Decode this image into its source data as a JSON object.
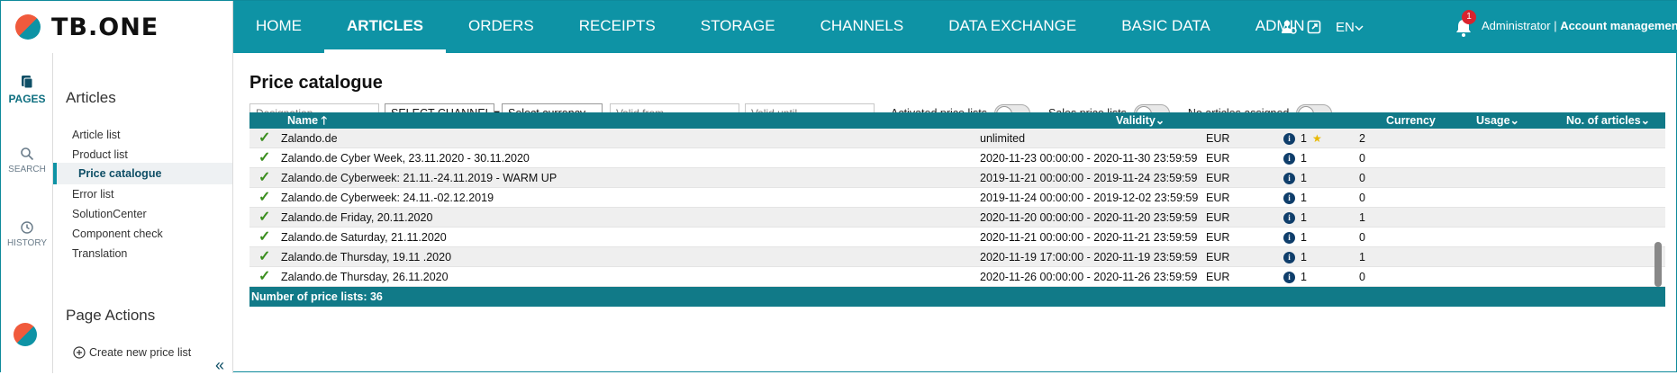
{
  "app": {
    "logo_text": "TB.ONE"
  },
  "nav": {
    "items": [
      {
        "label": "HOME",
        "active": false
      },
      {
        "label": "ARTICLES",
        "active": true
      },
      {
        "label": "ORDERS",
        "active": false
      },
      {
        "label": "RECEIPTS",
        "active": false
      },
      {
        "label": "STORAGE",
        "active": false
      },
      {
        "label": "CHANNELS",
        "active": false
      },
      {
        "label": "DATA EXCHANGE",
        "active": false
      },
      {
        "label": "BASIC DATA",
        "active": false
      },
      {
        "label": "ADMIN",
        "active": false
      }
    ],
    "language": "EN",
    "notification_count": "1",
    "user_name": "Administrator",
    "separator": " | ",
    "account_link": "Account management"
  },
  "rail": {
    "pages": "PAGES",
    "search": "SEARCH",
    "history": "HISTORY"
  },
  "sidebar": {
    "heading": "Articles",
    "links": [
      {
        "label": "Article list",
        "active": false
      },
      {
        "label": "Product list",
        "active": false
      },
      {
        "label": "Price catalogue",
        "active": true
      },
      {
        "label": "Error list",
        "active": false
      },
      {
        "label": "SolutionCenter",
        "active": false
      },
      {
        "label": "Component check",
        "active": false
      },
      {
        "label": "Translation",
        "active": false
      }
    ],
    "actions_heading": "Page Actions",
    "create_label": "Create new price list"
  },
  "main": {
    "title": "Price catalogue",
    "filters": {
      "designation_placeholder": "Designation",
      "channel_select": "SELECT CHANNEL",
      "currency_select": "Select currency",
      "valid_from_placeholder": "Valid from",
      "valid_until_placeholder": "Valid until",
      "toggle_activated": "Activated price lists",
      "toggle_sales": "Sales price lists",
      "toggle_no_articles": "No articles assigned"
    },
    "table": {
      "headers": {
        "name": "Name",
        "validity": "Validity",
        "currency": "Currency",
        "usage": "Usage",
        "articles": "No. of articles"
      },
      "rows": [
        {
          "name": "Zalando.de",
          "validity": "unlimited",
          "currency": "EUR",
          "usage": "1",
          "starred": true,
          "articles": "2"
        },
        {
          "name": "Zalando.de Cyber Week, 23.11.2020 - 30.11.2020",
          "validity": "2020-11-23 00:00:00 - 2020-11-30 23:59:59",
          "currency": "EUR",
          "usage": "1",
          "starred": false,
          "articles": "0"
        },
        {
          "name": "Zalando.de Cyberweek: 21.11.-24.11.2019 - WARM UP",
          "validity": "2019-11-21 00:00:00 - 2019-11-24 23:59:59",
          "currency": "EUR",
          "usage": "1",
          "starred": false,
          "articles": "0"
        },
        {
          "name": "Zalando.de Cyberweek: 24.11.-02.12.2019",
          "validity": "2019-11-24 00:00:00 - 2019-12-02 23:59:59",
          "currency": "EUR",
          "usage": "1",
          "starred": false,
          "articles": "0"
        },
        {
          "name": "Zalando.de Friday, 20.11.2020",
          "validity": "2020-11-20 00:00:00 - 2020-11-20 23:59:59",
          "currency": "EUR",
          "usage": "1",
          "starred": false,
          "articles": "1"
        },
        {
          "name": "Zalando.de Saturday, 21.11.2020",
          "validity": "2020-11-21 00:00:00 - 2020-11-21 23:59:59",
          "currency": "EUR",
          "usage": "1",
          "starred": false,
          "articles": "0"
        },
        {
          "name": "Zalando.de Thursday, 19.11 .2020",
          "validity": "2020-11-19 17:00:00 - 2020-11-19 23:59:59",
          "currency": "EUR",
          "usage": "1",
          "starred": false,
          "articles": "1"
        },
        {
          "name": "Zalando.de Thursday, 26.11.2020",
          "validity": "2020-11-26 00:00:00 - 2020-11-26 23:59:59",
          "currency": "EUR",
          "usage": "1",
          "starred": false,
          "articles": "0"
        }
      ],
      "footer": "Number of price lists: 36"
    }
  }
}
